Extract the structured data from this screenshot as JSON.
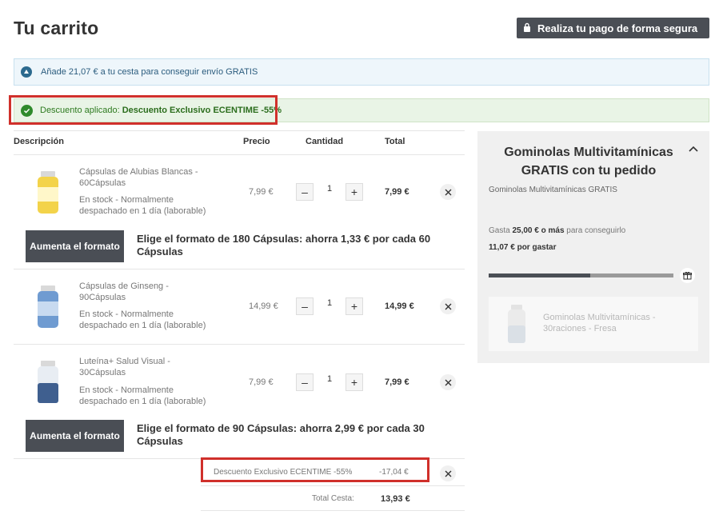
{
  "header": {
    "title": "Tu carrito",
    "secure_button": "Realiza tu pago de forma segura"
  },
  "banners": {
    "shipping": "Añade 21,07 € a tu cesta para conseguir envío GRATIS",
    "discount_prefix": "Descuento aplicado: ",
    "discount_name": "Descuento Exclusivo ECENTIME -55%"
  },
  "table": {
    "headers": {
      "description": "Descripción",
      "price": "Precio",
      "quantity": "Cantidad",
      "total": "Total"
    }
  },
  "items": [
    {
      "name_line1": "Cápsulas de Alubias Blancas -",
      "name_line2": "60Cápsulas",
      "stock_line1": "En stock  -  Normalmente",
      "stock_line2": "despachado en 1 día (laborable)",
      "price": "7,99 €",
      "quantity": "1",
      "total": "7,99 €",
      "thumb_color": "#f3d34a"
    },
    {
      "name_line1": "Cápsulas de Ginseng -",
      "name_line2": "90Cápsulas",
      "stock_line1": "En stock  -  Normalmente",
      "stock_line2": "despachado en 1 día (laborable)",
      "price": "14,99 €",
      "quantity": "1",
      "total": "14,99 €",
      "thumb_color": "#6f9bd1"
    },
    {
      "name_line1": "Luteína+ Salud Visual -",
      "name_line2": "30Cápsulas",
      "stock_line1": "En stock  -  Normalmente",
      "stock_line2": "despachado en 1 día (laborable)",
      "price": "7,99 €",
      "quantity": "1",
      "total": "7,99 €",
      "thumb_color": "#3f5f8f"
    }
  ],
  "upsells": [
    {
      "button": "Aumenta el formato",
      "text_prefix": "Elige el formato de ",
      "text_bold": "180 Cápsulas: ahorra 1,33 € por cada 60 Cápsulas"
    },
    {
      "button": "Aumenta el formato",
      "text_prefix": "Elige el formato de ",
      "text_bold": "90 Cápsulas: ahorra 2,99 € por cada 30 Cápsulas"
    }
  ],
  "summary": {
    "discount_label": "Descuento Exclusivo ECENTIME -55%",
    "discount_value": "-17,04 €",
    "total_label": "Total Cesta:",
    "total_value": "13,93 €"
  },
  "promo_panel": {
    "title": "Gominolas Multivitamínicas GRATIS con tu pedido",
    "subtitle": "Gominolas Multivitamínicas GRATIS",
    "spend_prefix": "Gasta ",
    "spend_amount": "25,00 € o más",
    "spend_suffix": " para conseguirlo",
    "remaining": "11,07 € por gastar",
    "progress": 0.55,
    "free_item_line1": "Gominolas Multivitamínicas -",
    "free_item_line2": "30raciones - Fresa"
  },
  "colors": {
    "dark_button": "#4a4e55",
    "success_green": "#2f8a2c",
    "highlight_red": "#d0302b",
    "info_blue": "#2c6a8e"
  }
}
